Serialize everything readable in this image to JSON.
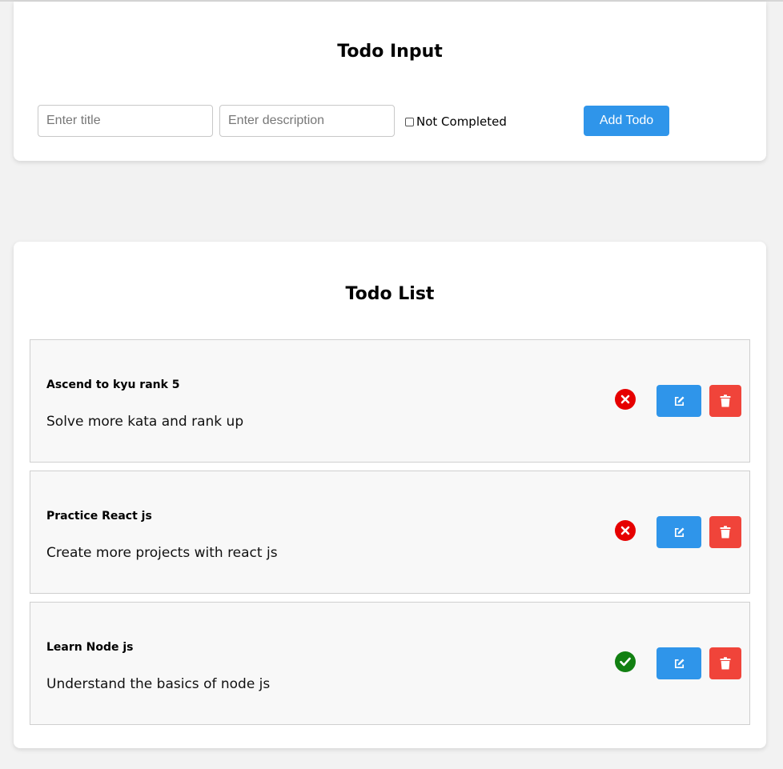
{
  "input_card": {
    "title": "Todo Input",
    "title_placeholder": "Enter title",
    "description_placeholder": "Enter description",
    "status_label": "Not Completed",
    "add_button_label": "Add Todo"
  },
  "list_card": {
    "title": "Todo List",
    "todos": [
      {
        "title": "Ascend to kyu rank 5",
        "description": "Solve more kata and rank up",
        "completed": false,
        "status_icon": "x-circle-icon"
      },
      {
        "title": "Practice React js",
        "description": "Create more projects with react js",
        "completed": false,
        "status_icon": "x-circle-icon"
      },
      {
        "title": "Learn Node js",
        "description": "Understand the basics of node js",
        "completed": true,
        "status_icon": "check-circle-icon"
      }
    ]
  },
  "icons": {
    "edit": "edit-icon",
    "delete": "trash-icon"
  },
  "colors": {
    "primary": "#2f95ea",
    "danger": "#f0443a",
    "not_completed": "#e60000",
    "completed": "#128012",
    "page_background": "#f2f2f2"
  }
}
